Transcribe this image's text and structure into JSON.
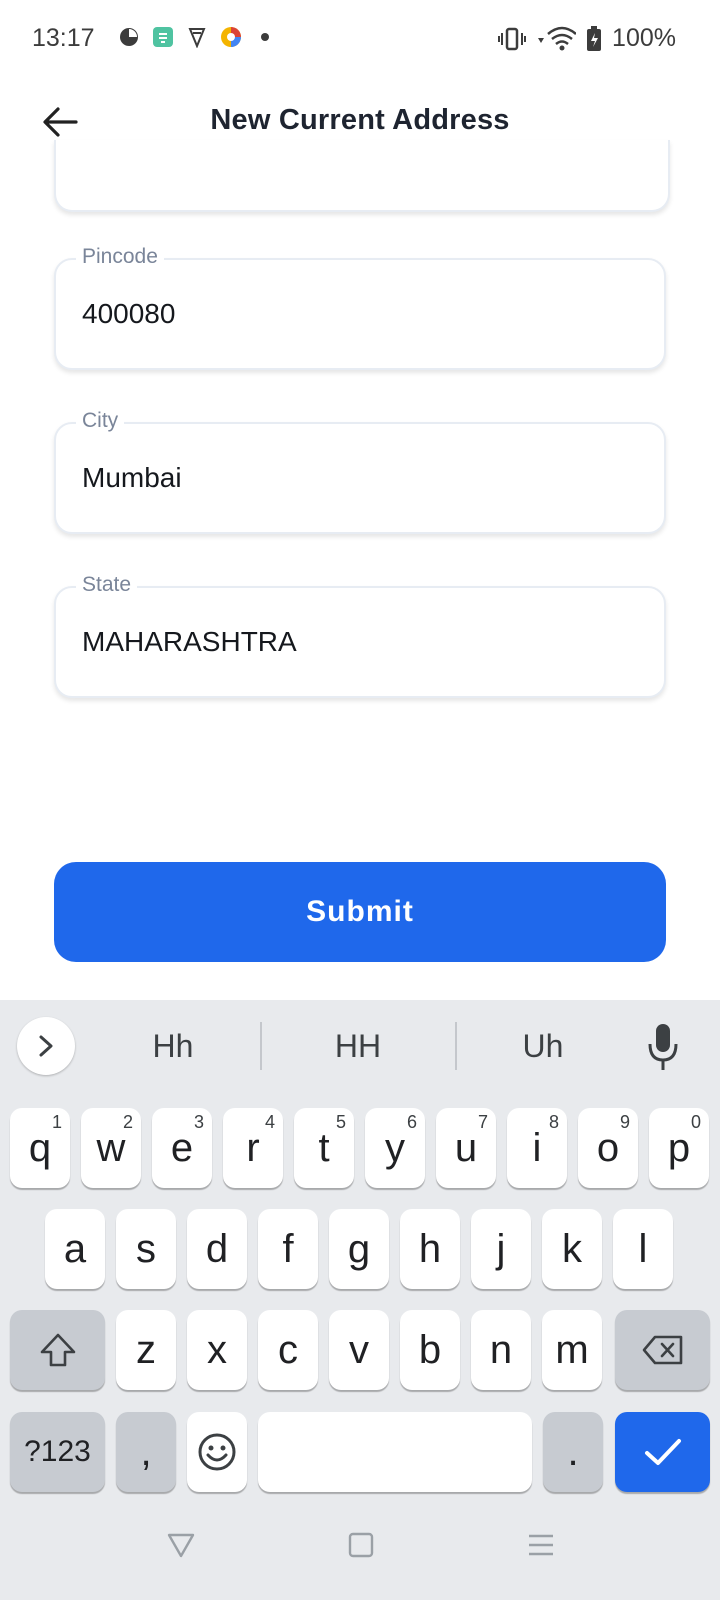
{
  "status": {
    "time": "13:17",
    "battery_text": "100%",
    "notif_icons": [
      "pie-icon",
      "app-icon",
      "shield-icon",
      "color-wheel-icon",
      "dot-icon"
    ],
    "system_icons": [
      "vibrate-icon",
      "wifi-icon",
      "battery-icon"
    ]
  },
  "appbar": {
    "title": "New Current Address",
    "back_icon": "back-arrow-icon"
  },
  "form": {
    "fields": [
      {
        "label": "Pincode",
        "value": "400080"
      },
      {
        "label": "City",
        "value": "Mumbai"
      },
      {
        "label": "State",
        "value": "MAHARASHTRA"
      }
    ],
    "submit_label": "Submit",
    "accent_color": "#1f68eb"
  },
  "keyboard": {
    "suggestions": [
      "Hh",
      "HH",
      "Uh"
    ],
    "row1": [
      {
        "k": "q",
        "h": "1"
      },
      {
        "k": "w",
        "h": "2"
      },
      {
        "k": "e",
        "h": "3"
      },
      {
        "k": "r",
        "h": "4"
      },
      {
        "k": "t",
        "h": "5"
      },
      {
        "k": "y",
        "h": "6"
      },
      {
        "k": "u",
        "h": "7"
      },
      {
        "k": "i",
        "h": "8"
      },
      {
        "k": "o",
        "h": "9"
      },
      {
        "k": "p",
        "h": "0"
      }
    ],
    "row2": [
      "a",
      "s",
      "d",
      "f",
      "g",
      "h",
      "j",
      "k",
      "l"
    ],
    "row3": [
      "z",
      "x",
      "c",
      "v",
      "b",
      "n",
      "m"
    ],
    "symbols_label": "?123",
    "comma": ",",
    "period": "."
  }
}
